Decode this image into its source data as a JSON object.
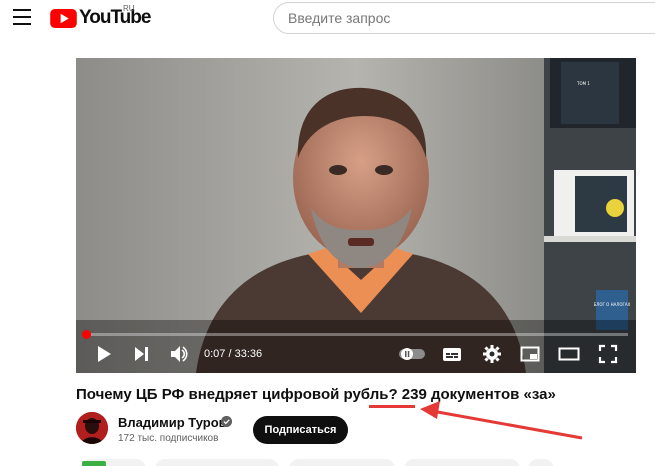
{
  "header": {
    "logo_text": "YouTube",
    "logo_region": "RU",
    "search_placeholder": "Введите запрос"
  },
  "player": {
    "time_display": "0:07 / 33:36",
    "progress_fraction": 0.0035,
    "book_title": "БЛОГ О НАЛОГАХ",
    "book_volume": "ТОМ 1"
  },
  "video": {
    "title": "Почему ЦБ РФ внедряет цифровой рубль? 239 документов «за»"
  },
  "channel": {
    "name": "Владимир Туров",
    "subscribers": "172 тыс. подписчиков",
    "subscribe_label": "Подписаться"
  },
  "colors": {
    "brand_red": "#ff0000",
    "annotation_red": "#e53935",
    "subscribe_bg": "#0f0f0f"
  }
}
